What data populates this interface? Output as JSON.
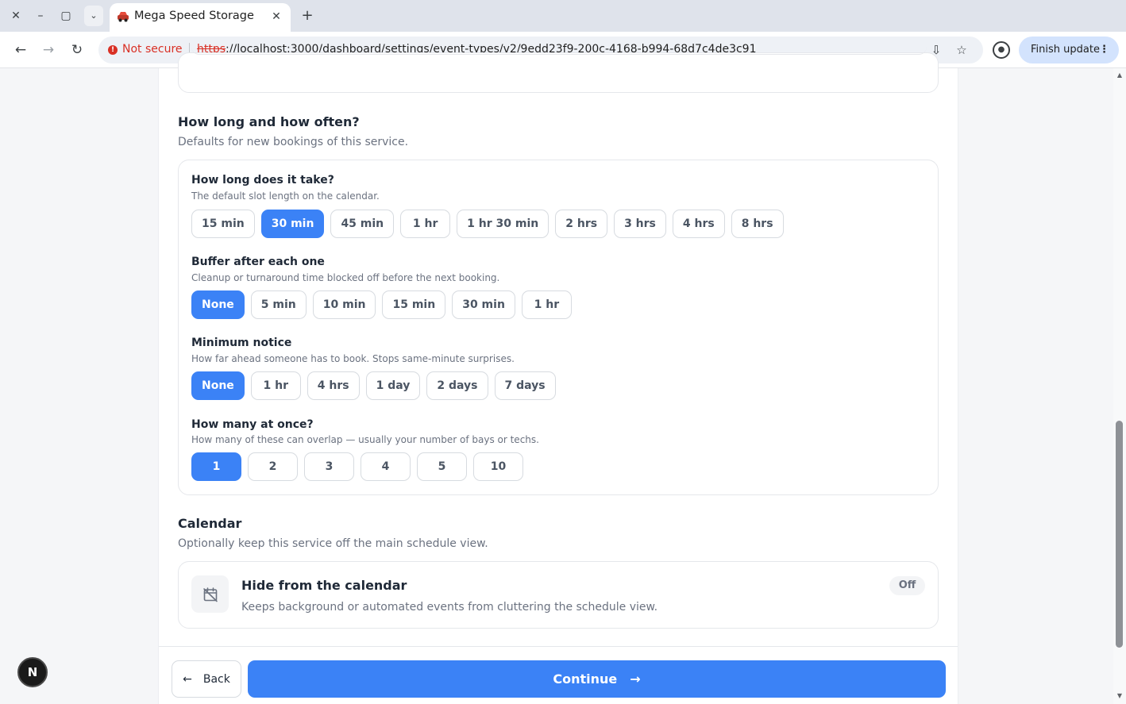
{
  "browser": {
    "tab_title": "Mega Speed Storage",
    "security_label": "Not secure",
    "url_scheme": "https",
    "url_rest": "://localhost:3000/dashboard/settings/event-types/v2/9edd23f9-200c-4168-b994-68d7c4de3c91",
    "update_button": "Finish update",
    "update_menu": "⋮"
  },
  "section_duration": {
    "title": "How long and how often?",
    "description": "Defaults for new bookings of this service.",
    "groups": [
      {
        "label": "How long does it take?",
        "description": "The default slot length on the calendar.",
        "options": [
          "15 min",
          "30 min",
          "45 min",
          "1 hr",
          "1 hr 30 min",
          "2 hrs",
          "3 hrs",
          "4 hrs",
          "8 hrs"
        ],
        "selected": "30 min"
      },
      {
        "label": "Buffer after each one",
        "description": "Cleanup or turnaround time blocked off before the next booking.",
        "options": [
          "None",
          "5 min",
          "10 min",
          "15 min",
          "30 min",
          "1 hr"
        ],
        "selected": "None"
      },
      {
        "label": "Minimum notice",
        "description": "How far ahead someone has to book. Stops same-minute surprises.",
        "options": [
          "None",
          "1 hr",
          "4 hrs",
          "1 day",
          "2 days",
          "7 days"
        ],
        "selected": "None"
      },
      {
        "label": "How many at once?",
        "description": "How many of these can overlap — usually your number of bays or techs.",
        "options": [
          "1",
          "2",
          "3",
          "4",
          "5",
          "10"
        ],
        "selected": "1"
      }
    ]
  },
  "section_calendar": {
    "title": "Calendar",
    "description": "Optionally keep this service off the main schedule view.",
    "toggle": {
      "title": "Hide from the calendar",
      "description": "Keeps background or automated events from cluttering the schedule view.",
      "state": "Off"
    }
  },
  "footer": {
    "back_label": "Back",
    "continue_label": "Continue"
  },
  "dev_badge": "N",
  "colors": {
    "accent": "#3b82f6",
    "danger": "#d93025"
  }
}
